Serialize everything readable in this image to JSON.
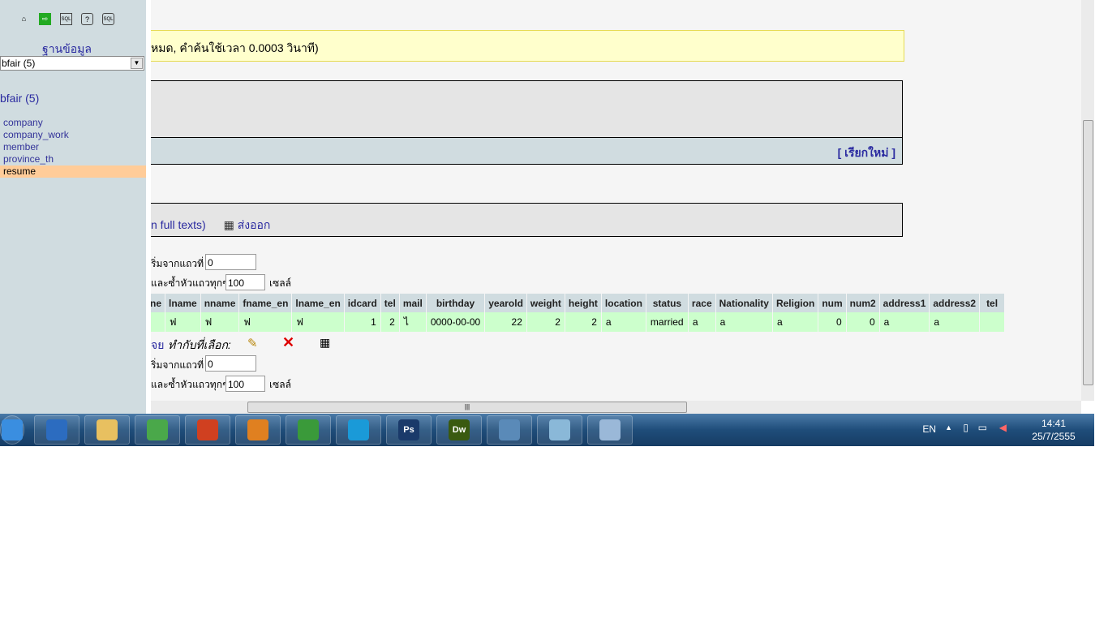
{
  "sidebar": {
    "icons": [
      "home-icon",
      "exit-icon",
      "sql-query-icon",
      "help-icon",
      "sql-docs-icon"
    ],
    "db_label": "ฐานข้อมูล",
    "db_select": "bfair (5)",
    "db_title": "bfair (5)",
    "tables": [
      "company",
      "company_work",
      "member",
      "province_th",
      "resume"
    ],
    "active_table": "resume"
  },
  "main": {
    "notice": "หมด, คำค้นใช้เวลา 0.0003 วินาที)",
    "refresh": "[ เรียกใหม่ ]",
    "full_texts": "n full texts)",
    "export": "ส่งออก",
    "nav_top": {
      "start_label": "ริ่มจากแถวที่",
      "start_value": "0",
      "repeat_label": "และซ้ำหัวแถวทุกๆ",
      "repeat_value": "100",
      "cells_label": "เซลล์"
    },
    "nav_bottom": {
      "start_label": "ริ่มจากแถวที่",
      "start_value": "0",
      "repeat_label": "และซ้ำหัวแถวทุกๆ",
      "repeat_value": "100",
      "cells_label": "เซลล์"
    },
    "with_selected_link": "จย",
    "with_selected": "ทำกับที่เลือก:",
    "columns": [
      "ne",
      "lname",
      "nname",
      "fname_en",
      "lname_en",
      "idcard",
      "tel",
      "mail",
      "birthday",
      "yearold",
      "weight",
      "height",
      "location",
      "status",
      "race",
      "Nationality",
      "Religion",
      "num",
      "num2",
      "address1",
      "address2",
      "tel"
    ],
    "rows": [
      [
        "",
        "ฟ",
        "ฟ",
        "ฟ",
        "ฟ",
        "1",
        "2",
        "ไ",
        "0000-00-00",
        "22",
        "2",
        "2",
        "a",
        "married",
        "a",
        "a",
        "a",
        "0",
        "0",
        "a",
        "a",
        ""
      ]
    ]
  },
  "taskbar": {
    "apps": [
      "Start",
      "Internet Explorer",
      "Explorer",
      "Chrome",
      "FileZilla",
      "Media",
      "Network",
      "Skype",
      "Ps",
      "Dw",
      "Photo",
      "Paint",
      "Notepad"
    ],
    "lang": "EN",
    "time": "14:41",
    "date": "25/7/2555"
  }
}
